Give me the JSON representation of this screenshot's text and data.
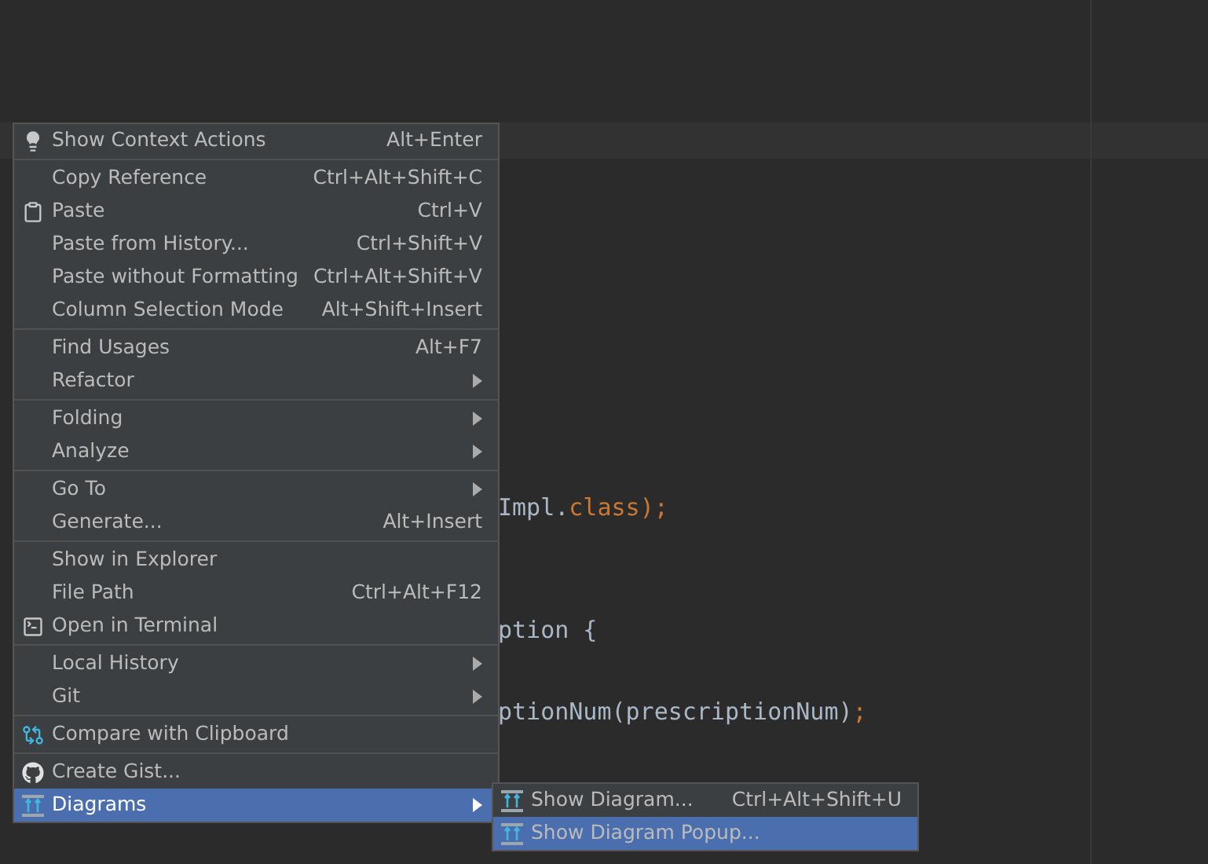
{
  "editor": {
    "code_lines": [
      {
        "tokens": [
          {
            "text": "Impl.",
            "kind": "plain"
          },
          {
            "text": "class",
            "kind": "keyword"
          },
          {
            "text": ");",
            "kind": "punct"
          }
        ]
      },
      {
        "tokens": [
          {
            "text": "ption {",
            "kind": "plain"
          }
        ]
      },
      {
        "tokens": [
          {
            "text": "ptionNum(prescriptionNum)",
            "kind": "plain"
          },
          {
            "text": ";",
            "kind": "punct"
          }
        ]
      }
    ]
  },
  "context_menu": {
    "groups": [
      {
        "items": [
          {
            "label": "Show Context Actions",
            "shortcut": "Alt+Enter",
            "kind": "bulb",
            "has_submenu": false,
            "selected": false
          }
        ]
      },
      {
        "items": [
          {
            "label": "Copy Reference",
            "shortcut": "Ctrl+Alt+Shift+C",
            "kind": "plain",
            "has_submenu": false,
            "selected": false
          },
          {
            "label": "Paste",
            "shortcut": "Ctrl+V",
            "kind": "clipboard",
            "has_submenu": false,
            "selected": false
          },
          {
            "label": "Paste from History...",
            "shortcut": "Ctrl+Shift+V",
            "kind": "plain",
            "has_submenu": false,
            "selected": false
          },
          {
            "label": "Paste without Formatting",
            "shortcut": "Ctrl+Alt+Shift+V",
            "kind": "plain",
            "has_submenu": false,
            "selected": false
          },
          {
            "label": "Column Selection Mode",
            "shortcut": "Alt+Shift+Insert",
            "kind": "plain",
            "has_submenu": false,
            "selected": false
          }
        ]
      },
      {
        "items": [
          {
            "label": "Find Usages",
            "shortcut": "Alt+F7",
            "kind": "plain",
            "has_submenu": false,
            "selected": false
          },
          {
            "label": "Refactor",
            "kind": "plain",
            "has_submenu": true,
            "selected": false
          }
        ]
      },
      {
        "items": [
          {
            "label": "Folding",
            "kind": "plain",
            "has_submenu": true,
            "selected": false
          },
          {
            "label": "Analyze",
            "kind": "plain",
            "has_submenu": true,
            "selected": false
          }
        ]
      },
      {
        "items": [
          {
            "label": "Go To",
            "kind": "plain",
            "has_submenu": true,
            "selected": false
          },
          {
            "label": "Generate...",
            "shortcut": "Alt+Insert",
            "kind": "plain",
            "has_submenu": false,
            "selected": false
          }
        ]
      },
      {
        "items": [
          {
            "label": "Show in Explorer",
            "kind": "plain",
            "has_submenu": false,
            "selected": false
          },
          {
            "label": "File Path",
            "shortcut": "Ctrl+Alt+F12",
            "kind": "plain",
            "has_submenu": false,
            "selected": false
          },
          {
            "label": "Open in Terminal",
            "kind": "terminal",
            "has_submenu": false,
            "selected": false
          }
        ]
      },
      {
        "items": [
          {
            "label": "Local History",
            "kind": "plain",
            "has_submenu": true,
            "selected": false
          },
          {
            "label": "Git",
            "kind": "plain",
            "has_submenu": true,
            "selected": false
          }
        ]
      },
      {
        "items": [
          {
            "label": "Compare with Clipboard",
            "kind": "compare",
            "has_submenu": false,
            "selected": false
          }
        ]
      },
      {
        "items": [
          {
            "label": "Create Gist...",
            "kind": "github",
            "has_submenu": false,
            "selected": false
          },
          {
            "label": "Diagrams",
            "kind": "diagram",
            "has_submenu": true,
            "selected": true
          }
        ]
      }
    ]
  },
  "submenu": {
    "items": [
      {
        "label": "Show Diagram...",
        "shortcut": "Ctrl+Alt+Shift+U",
        "kind": "diagram",
        "selected": false
      },
      {
        "label": "Show Diagram Popup...",
        "kind": "diagram",
        "selected": true
      }
    ]
  }
}
